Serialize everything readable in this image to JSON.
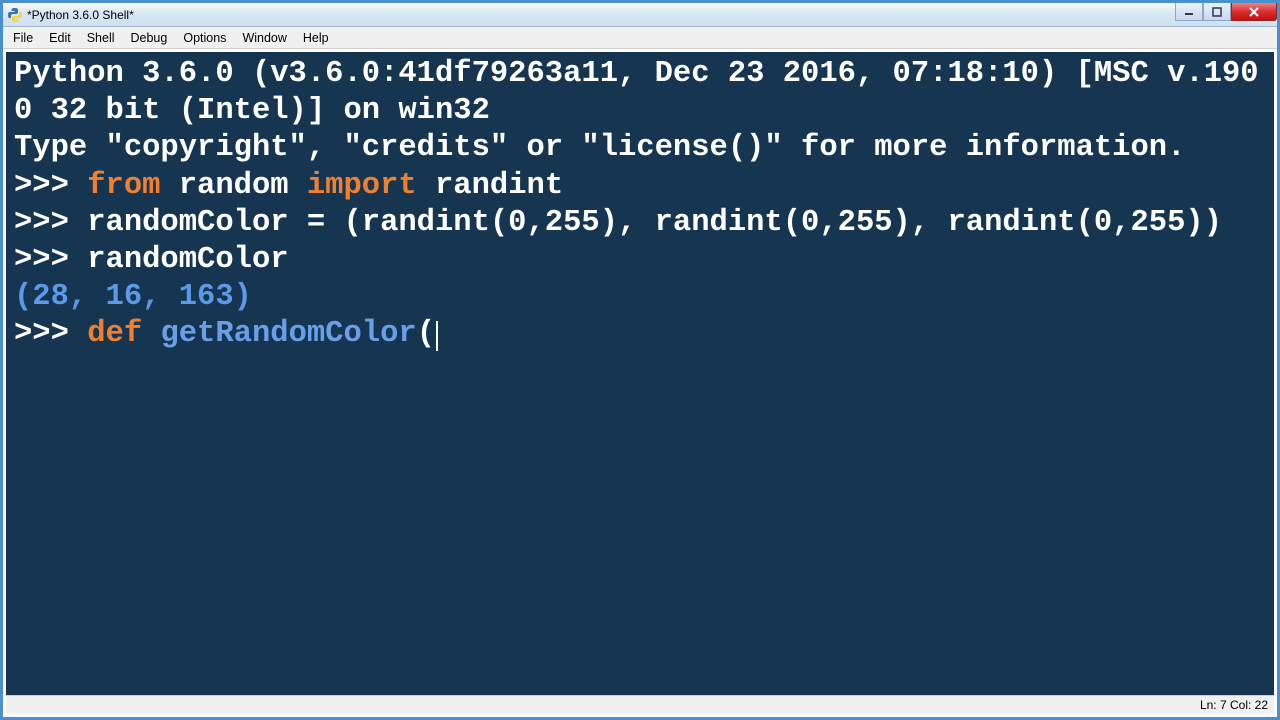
{
  "window": {
    "title": "*Python 3.6.0 Shell*"
  },
  "menu": {
    "file": "File",
    "edit": "Edit",
    "shell": "Shell",
    "debug": "Debug",
    "options": "Options",
    "window": "Window",
    "help": "Help"
  },
  "shell": {
    "banner_line1": "Python 3.6.0 (v3.6.0:41df79263a11, Dec 23 2016, 07:18:10) [MSC v.1900 32 bit (Intel)] on win32",
    "banner_line2": "Type \"copyright\", \"credits\" or \"license()\" for more information.",
    "prompt": ">>> ",
    "line1_kw_from": "from",
    "line1_mod": " random ",
    "line1_kw_import": "import",
    "line1_name": " randint",
    "line2": "randomColor = (randint(0,255), randint(0,255), randint(0,255))",
    "line3": "randomColor",
    "output1": "(28, 16, 163)",
    "line4_kw_def": "def",
    "line4_space": " ",
    "line4_fn": "getRandomColor",
    "line4_paren": "("
  },
  "status": {
    "pos": "Ln: 7  Col: 22"
  }
}
